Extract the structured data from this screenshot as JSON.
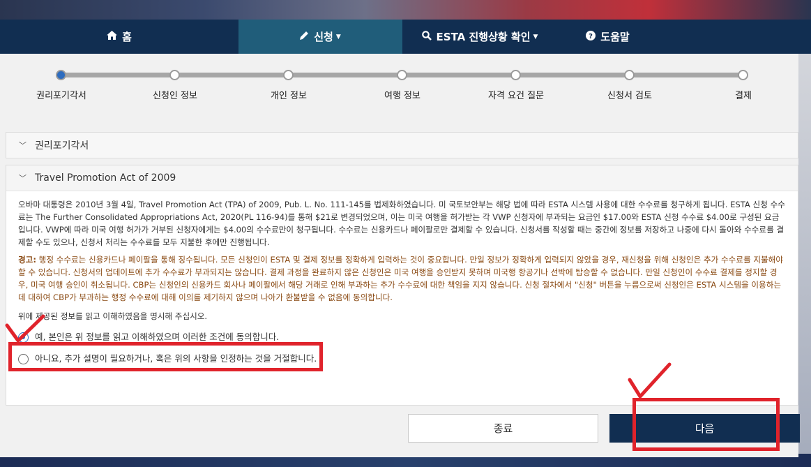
{
  "nav": {
    "items": [
      {
        "label": "홈",
        "icon": "home-icon",
        "active": false
      },
      {
        "label": "신청",
        "icon": "pencil-icon",
        "active": true,
        "caret": true
      },
      {
        "label": "ESTA 진행상황 확인",
        "icon": "search-icon",
        "active": false,
        "caret": true
      },
      {
        "label": "도움말",
        "icon": "help-icon",
        "active": false
      }
    ]
  },
  "progress": {
    "steps": [
      "권리포기각서",
      "신청인 정보",
      "개인 정보",
      "여행 정보",
      "자격 요건 질문",
      "신청서 검토",
      "결제"
    ],
    "current_index": 0
  },
  "waiver_section": {
    "title": "권리포기각서"
  },
  "travel_section": {
    "title": "Travel Promotion Act of 2009",
    "paragraph": "오바마 대통령은 2010년 3월 4일, Travel Promotion Act (TPA) of 2009, Pub. L. No. 111-145를 법제화하였습니다. 미 국토보안부는 해당 법에 따라 ESTA 시스템 사용에 대한 수수료를 청구하게 됩니다. ESTA 신청 수수료는 The Further Consolidated Appropriations Act, 2020(PL 116-94)를 통해 $21로 변경되었으며, 이는 미국 여행을 허가받는 각 VWP 신청자에 부과되는 요금인 $17.00와 ESTA 신청 수수료 $4.00로 구성된 요금입니다. VWP에 따라 미국 여행 허가가 거부된 신청자에게는 $4.00의 수수료만이 청구됩니다. 수수료는 신용카드나 페이팔로만 결제할 수 있습니다. 신청서를 작성할 때는 중간에 정보를 저장하고 나중에 다시 돌아와 수수료를 결제할 수도 있으나, 신청서 처리는 수수료를 모두 지불한 후에만 진행됩니다.",
    "warning_label": "경고:",
    "warning_text": " 행정 수수료는 신용카드나 페이팔을 통해 징수됩니다. 모든 신청인이 ESTA 및 결제 정보를 정확하게 입력하는 것이 중요합니다. 만일 정보가 정확하게 입력되지 않았을 경우, 재신청을 위해 신청인은 추가 수수료를 지불해야 할 수 있습니다. 신청서의 업데이트에 추가 수수료가 부과되지는 않습니다. 결제 과정을 완료하지 않은 신청인은 미국 여행을 승인받지 못하며 미국행 항공기나 선박에 탑승할 수 없습니다. 만일 신청인이 수수료 결제를 정지할 경우, 미국 여행 승인이 취소됩니다. CBP는 신청인의 신용카드 회사나 페이팔에서 해당 거래로 인해 부과하는 추가 수수료에 대한 책임을 지지 않습니다. 신청 절차에서 \"신청\" 버튼을 누름으로써 신청인은 ESTA 시스템을 이용하는 데 대하여 CBP가 부과하는 행정 수수료에 대해 이의를 제기하지 않으며 나아가 환불받을 수 없음에 동의합니다.",
    "confirm_prompt": "위에 제공된 정보를 읽고 이해하였음을 명시해 주십시오.",
    "options": [
      {
        "label": "예, 본인은 위 정보를 읽고 이해하였으며 이러한 조건에 동의합니다.",
        "checked": true
      },
      {
        "label": "아니요, 추가 설명이 필요하거나, 혹은 위의 사항을 인정하는 것을 거절합니다.",
        "checked": false
      }
    ]
  },
  "buttons": {
    "close": "종료",
    "next": "다음"
  },
  "colors": {
    "navbar": "#112e51",
    "nav_active": "#205d7a",
    "accent": "#2d6cbf",
    "warning_text": "#8a4a13",
    "annotation": "#e0232b"
  }
}
